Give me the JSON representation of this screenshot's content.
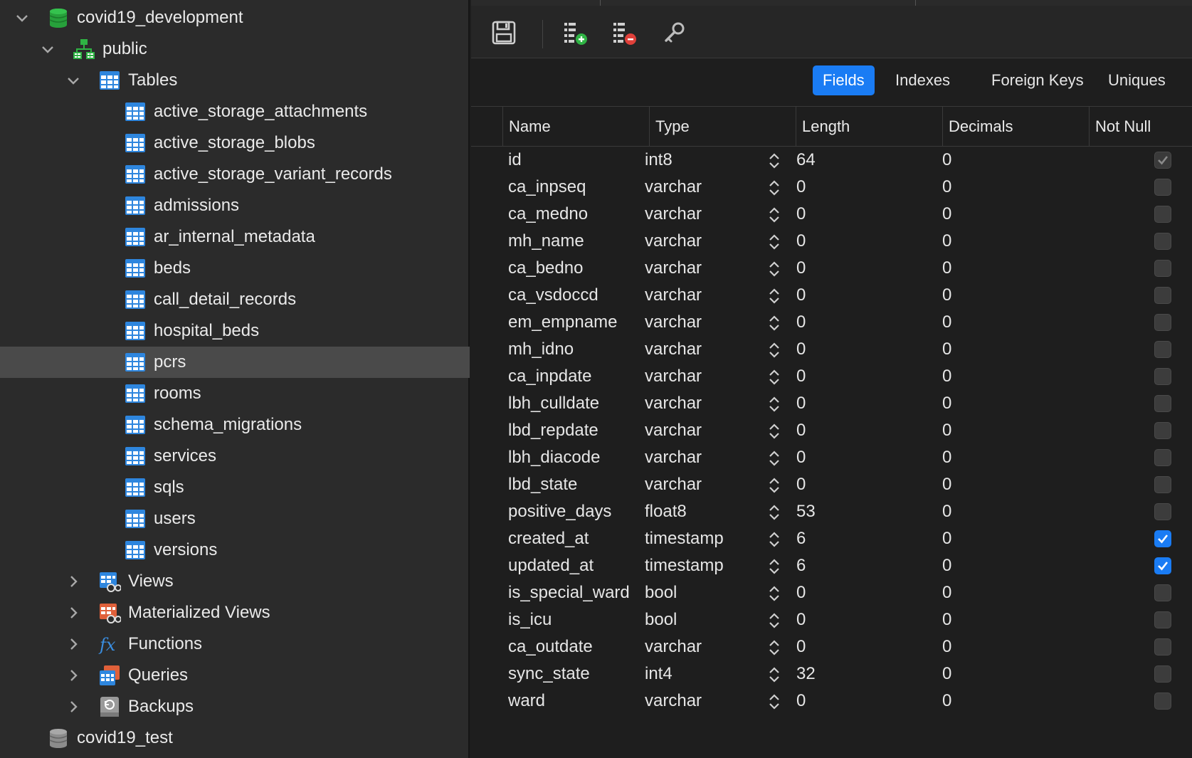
{
  "sidebar": {
    "tree": [
      {
        "label": "covid19_development",
        "icon": "database-green-icon",
        "chevron": "down",
        "level": 0
      },
      {
        "label": "public",
        "icon": "schema-icon",
        "chevron": "down",
        "level": 1
      },
      {
        "label": "Tables",
        "icon": "tables-folder-icon",
        "chevron": "down",
        "level": 2
      },
      {
        "label": "active_storage_attachments",
        "icon": "table-icon",
        "chevron": "none",
        "level": 3
      },
      {
        "label": "active_storage_blobs",
        "icon": "table-icon",
        "chevron": "none",
        "level": 3
      },
      {
        "label": "active_storage_variant_records",
        "icon": "table-icon",
        "chevron": "none",
        "level": 3
      },
      {
        "label": "admissions",
        "icon": "table-icon",
        "chevron": "none",
        "level": 3
      },
      {
        "label": "ar_internal_metadata",
        "icon": "table-icon",
        "chevron": "none",
        "level": 3
      },
      {
        "label": "beds",
        "icon": "table-icon",
        "chevron": "none",
        "level": 3
      },
      {
        "label": "call_detail_records",
        "icon": "table-icon",
        "chevron": "none",
        "level": 3
      },
      {
        "label": "hospital_beds",
        "icon": "table-icon",
        "chevron": "none",
        "level": 3
      },
      {
        "label": "pcrs",
        "icon": "table-icon",
        "chevron": "none",
        "level": 3,
        "selected": true
      },
      {
        "label": "rooms",
        "icon": "table-icon",
        "chevron": "none",
        "level": 3
      },
      {
        "label": "schema_migrations",
        "icon": "table-icon",
        "chevron": "none",
        "level": 3
      },
      {
        "label": "services",
        "icon": "table-icon",
        "chevron": "none",
        "level": 3
      },
      {
        "label": "sqls",
        "icon": "table-icon",
        "chevron": "none",
        "level": 3
      },
      {
        "label": "users",
        "icon": "table-icon",
        "chevron": "none",
        "level": 3
      },
      {
        "label": "versions",
        "icon": "table-icon",
        "chevron": "none",
        "level": 3
      },
      {
        "label": "Views",
        "icon": "views-icon",
        "chevron": "right",
        "level": 2
      },
      {
        "label": "Materialized Views",
        "icon": "materialized-views-icon",
        "chevron": "right",
        "level": 2
      },
      {
        "label": "Functions",
        "icon": "function-icon",
        "chevron": "right",
        "level": 2
      },
      {
        "label": "Queries",
        "icon": "queries-icon",
        "chevron": "right",
        "level": 2
      },
      {
        "label": "Backups",
        "icon": "backup-icon",
        "chevron": "right",
        "level": 2
      },
      {
        "label": "covid19_test",
        "icon": "database-grey-icon",
        "chevron": "none",
        "level": 0
      }
    ]
  },
  "toolbar": {
    "buttons": [
      "save-icon",
      "add-field-icon",
      "delete-field-icon",
      "key-icon"
    ]
  },
  "segments": {
    "fields": "Fields",
    "indexes": "Indexes",
    "foreign_keys": "Foreign Keys",
    "uniques": "Uniques",
    "active": "fields"
  },
  "columns": {
    "name": "Name",
    "type": "Type",
    "length": "Length",
    "decimals": "Decimals",
    "not_null": "Not Null"
  },
  "fields": [
    {
      "name": "id",
      "type": "int8",
      "length": "64",
      "decimals": "0",
      "not_null": "dim"
    },
    {
      "name": "ca_inpseq",
      "type": "varchar",
      "length": "0",
      "decimals": "0",
      "not_null": "off"
    },
    {
      "name": "ca_medno",
      "type": "varchar",
      "length": "0",
      "decimals": "0",
      "not_null": "off"
    },
    {
      "name": "mh_name",
      "type": "varchar",
      "length": "0",
      "decimals": "0",
      "not_null": "off"
    },
    {
      "name": "ca_bedno",
      "type": "varchar",
      "length": "0",
      "decimals": "0",
      "not_null": "off"
    },
    {
      "name": "ca_vsdoccd",
      "type": "varchar",
      "length": "0",
      "decimals": "0",
      "not_null": "off"
    },
    {
      "name": "em_empname",
      "type": "varchar",
      "length": "0",
      "decimals": "0",
      "not_null": "off"
    },
    {
      "name": "mh_idno",
      "type": "varchar",
      "length": "0",
      "decimals": "0",
      "not_null": "off"
    },
    {
      "name": "ca_inpdate",
      "type": "varchar",
      "length": "0",
      "decimals": "0",
      "not_null": "off"
    },
    {
      "name": "lbh_culldate",
      "type": "varchar",
      "length": "0",
      "decimals": "0",
      "not_null": "off"
    },
    {
      "name": "lbd_repdate",
      "type": "varchar",
      "length": "0",
      "decimals": "0",
      "not_null": "off"
    },
    {
      "name": "lbh_diacode",
      "type": "varchar",
      "length": "0",
      "decimals": "0",
      "not_null": "off"
    },
    {
      "name": "lbd_state",
      "type": "varchar",
      "length": "0",
      "decimals": "0",
      "not_null": "off"
    },
    {
      "name": "positive_days",
      "type": "float8",
      "length": "53",
      "decimals": "0",
      "not_null": "off"
    },
    {
      "name": "created_at",
      "type": "timestamp",
      "length": "6",
      "decimals": "0",
      "not_null": "on"
    },
    {
      "name": "updated_at",
      "type": "timestamp",
      "length": "6",
      "decimals": "0",
      "not_null": "on"
    },
    {
      "name": "is_special_ward",
      "type": "bool",
      "length": "0",
      "decimals": "0",
      "not_null": "off"
    },
    {
      "name": "is_icu",
      "type": "bool",
      "length": "0",
      "decimals": "0",
      "not_null": "off"
    },
    {
      "name": "ca_outdate",
      "type": "varchar",
      "length": "0",
      "decimals": "0",
      "not_null": "off"
    },
    {
      "name": "sync_state",
      "type": "int4",
      "length": "32",
      "decimals": "0",
      "not_null": "off"
    },
    {
      "name": "ward",
      "type": "varchar",
      "length": "0",
      "decimals": "0",
      "not_null": "off"
    }
  ],
  "colors": {
    "accent": "#1a7cf4",
    "sidebar_bg": "#2b2b2b",
    "selected_row": "#4a4a4a",
    "main_bg": "#1e1e1e"
  }
}
